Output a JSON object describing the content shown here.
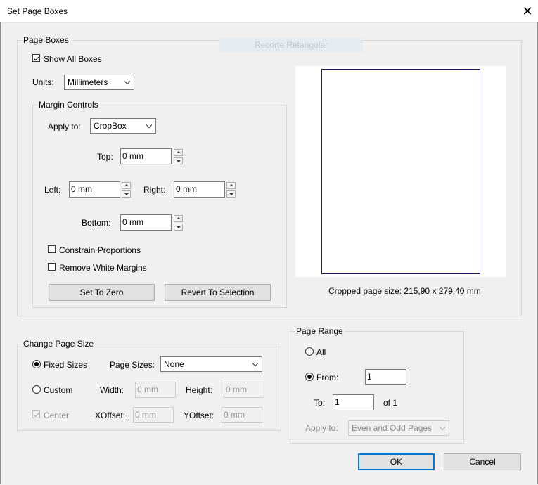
{
  "window": {
    "title": "Set Page Boxes",
    "close_glyph": "✕"
  },
  "ghost_text": "Recorte Retangular",
  "page_boxes": {
    "legend": "Page Boxes",
    "show_all_boxes": {
      "label": "Show All Boxes",
      "checked": true
    },
    "units": {
      "label": "Units:",
      "value": "Millimeters"
    },
    "margin_controls": {
      "legend": "Margin Controls",
      "apply_to": {
        "label": "Apply to:",
        "value": "CropBox"
      },
      "top": {
        "label": "Top:",
        "value": "0 mm"
      },
      "left": {
        "label": "Left:",
        "value": "0 mm"
      },
      "right": {
        "label": "Right:",
        "value": "0 mm"
      },
      "bottom": {
        "label": "Bottom:",
        "value": "0 mm"
      },
      "constrain": {
        "label": "Constrain Proportions",
        "checked": false
      },
      "remove_white": {
        "label": "Remove White Margins",
        "checked": false
      },
      "set_to_zero": "Set To Zero",
      "revert": "Revert To Selection"
    },
    "cropped_size": "Cropped page size: 215,90 x 279,40 mm"
  },
  "change_page_size": {
    "legend": "Change Page Size",
    "fixed_sizes": {
      "label": "Fixed Sizes",
      "selected": true
    },
    "page_sizes": {
      "label": "Page Sizes:",
      "value": "None"
    },
    "custom": {
      "label": "Custom",
      "selected": false
    },
    "width": {
      "label": "Width:",
      "value": "0 mm"
    },
    "height": {
      "label": "Height:",
      "value": "0 mm"
    },
    "center": {
      "label": "Center",
      "checked": true
    },
    "xoffset": {
      "label": "XOffset:",
      "value": "0 mm"
    },
    "yoffset": {
      "label": "YOffset:",
      "value": "0 mm"
    }
  },
  "page_range": {
    "legend": "Page Range",
    "all": {
      "label": "All",
      "selected": false
    },
    "from": {
      "label": "From:",
      "value": "1",
      "selected": true
    },
    "to": {
      "label": "To:",
      "value": "1"
    },
    "of_total": "of 1",
    "apply_to": {
      "label": "Apply to:",
      "value": "Even and Odd Pages"
    }
  },
  "buttons": {
    "ok": "OK",
    "cancel": "Cancel"
  },
  "colors": {
    "page_border": "#1b1b5e",
    "default_button": "#0078d7"
  }
}
